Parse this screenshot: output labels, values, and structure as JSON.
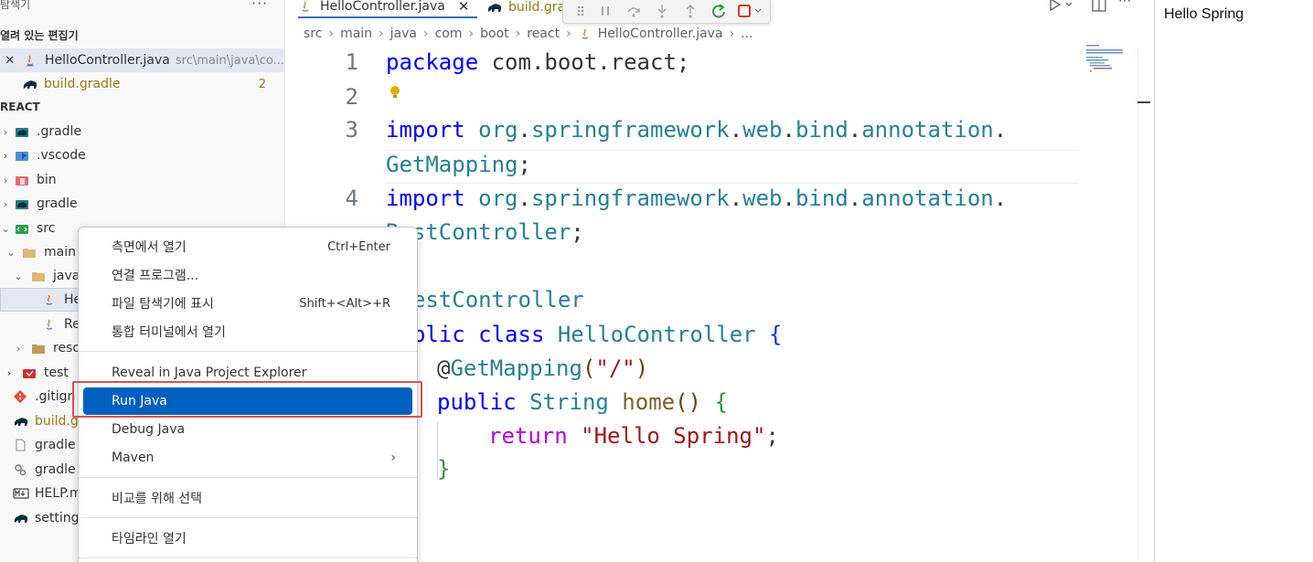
{
  "sidebar": {
    "title": "탐색기",
    "more": "···",
    "open_editors_label": "열려 있는 편집기",
    "open_editors": [
      {
        "close": "✕",
        "name": "HelloController.java",
        "path": "src\\main\\java\\co..."
      },
      {
        "name": "build.gradle",
        "badge": "2"
      }
    ],
    "project_label": "REACT",
    "tree": [
      {
        "chev": "›",
        "label": ".gradle"
      },
      {
        "chev": "›",
        "label": ".vscode"
      },
      {
        "chev": "›",
        "label": "bin"
      },
      {
        "chev": "›",
        "label": "gradle"
      },
      {
        "chev": "⌄",
        "label": "src"
      },
      {
        "chev": "⌄",
        "label": "main"
      },
      {
        "chev": "⌄",
        "label": "java"
      },
      {
        "chev": "",
        "label": "He"
      },
      {
        "chev": "",
        "label": "Re"
      },
      {
        "chev": "›",
        "label": "reso"
      },
      {
        "chev": "›",
        "label": "test"
      },
      {
        "chev": "",
        "label": ".gitign"
      },
      {
        "chev": "",
        "label": "build.g"
      },
      {
        "chev": "",
        "label": "gradle"
      },
      {
        "chev": "",
        "label": "gradle"
      },
      {
        "chev": "",
        "label": "HELP.m"
      },
      {
        "chev": "",
        "label": "setting"
      }
    ]
  },
  "editor": {
    "tabs": [
      {
        "label": "HelloController.java",
        "close": "✕"
      },
      {
        "label": "build.gra"
      }
    ],
    "breadcrumb": [
      "src",
      "main",
      "java",
      "com",
      "boot",
      "react",
      "HelloController.java",
      "..."
    ],
    "line_numbers": [
      "1",
      "2",
      "3",
      "4"
    ],
    "code": {
      "l1_kw": "package",
      "l1_rest": " com.boot.react;",
      "l3_kw": "import",
      "l3_a": " org",
      "l3_b": ".",
      "l3_c": "springframework",
      "l3_d": ".",
      "l3_e": "web",
      "l3_f": ".",
      "l3_g": "bind",
      "l3_h": ".",
      "l3_i": "annotation",
      "l3_j": ".",
      "l3w_type": "GetMapping",
      "l3w_semi": ";",
      "l4_kw": "import",
      "l4_a": " org",
      "l4_b": ".",
      "l4_c": "springframework",
      "l4_d": ".",
      "l4_e": "web",
      "l4_f": ".",
      "l4_g": "bind",
      "l4_h": ".",
      "l4_i": "annotation",
      "l4_j": ".",
      "l4w_type": "RestController",
      "l4w_semi": ";",
      "ann_rc": "@RestController",
      "cls_kw1": "public",
      "cls_kw2": " class",
      "cls_name": " HelloController",
      "cls_brace": " {",
      "gm_at": "@",
      "gm_name": "GetMapping",
      "gm_open": "(",
      "gm_str": "\"/\"",
      "gm_close": ")",
      "m_kw": "public",
      "m_type": " String",
      "m_name": " home",
      "m_parens": "()",
      "m_brace": " {",
      "r_kw": "return",
      "r_str": " \"Hello Spring\"",
      "r_semi": ";",
      "close_brace": "}"
    }
  },
  "right_panel": {
    "text": "Hello Spring"
  },
  "context_menu": {
    "items": [
      {
        "label": "측면에서 열기",
        "shortcut": "Ctrl+Enter"
      },
      {
        "label": "연결 프로그램...",
        "shortcut": ""
      },
      {
        "label": "파일 탐색기에 표시",
        "shortcut": "Shift+<Alt>+R"
      },
      {
        "label": "통합 터미널에서 열기",
        "shortcut": ""
      },
      {
        "label": "Reveal in Java Project Explorer",
        "shortcut": ""
      },
      {
        "label": "Run Java",
        "shortcut": ""
      },
      {
        "label": "Debug Java",
        "shortcut": ""
      },
      {
        "label": "Maven",
        "shortcut": "›"
      },
      {
        "label": "비교를 위해 선택",
        "shortcut": ""
      },
      {
        "label": "타임라인 열기",
        "shortcut": ""
      }
    ]
  },
  "colors": {
    "accent": "#0060c0",
    "highlight_box": "#e05050",
    "keyword": "#0000ff",
    "type": "#267f99",
    "string": "#a31515"
  }
}
